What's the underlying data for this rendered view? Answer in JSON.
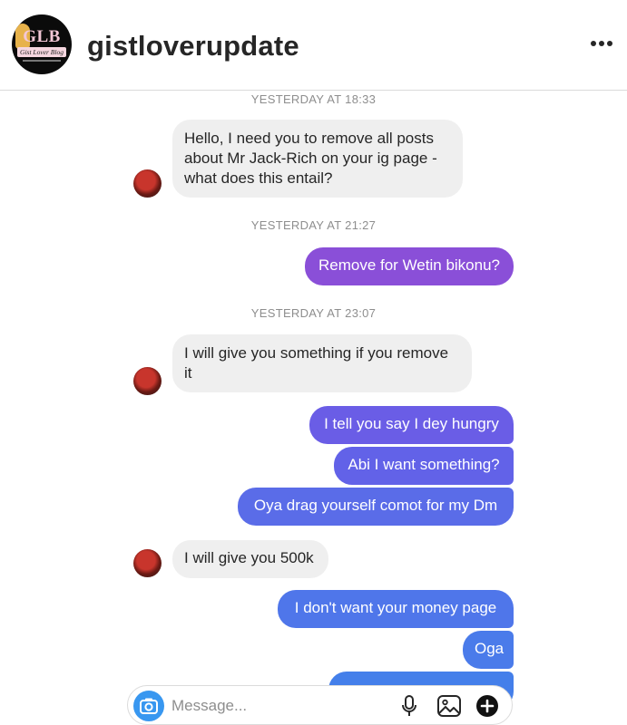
{
  "header": {
    "username": "gistloverupdate",
    "avatar": {
      "logo_text": "GLB",
      "logo_sub": "Gist Lover Blog"
    },
    "more_icon": "more-horizontal-icon"
  },
  "thread": [
    {
      "kind": "timestamp",
      "text": "YESTERDAY AT 18:33"
    },
    {
      "kind": "incoming",
      "text": "Hello, I need you to remove all posts about Mr Jack-Rich on your ig page - what does this entail?"
    },
    {
      "kind": "timestamp",
      "text": "YESTERDAY AT 21:27"
    },
    {
      "kind": "outgoing",
      "text": "Remove for Wetin bikonu?"
    },
    {
      "kind": "timestamp",
      "text": "YESTERDAY AT 23:07"
    },
    {
      "kind": "incoming",
      "text": "I will give you something if you remove it"
    },
    {
      "kind": "outgoing",
      "text": "I tell you say I dey hungry"
    },
    {
      "kind": "outgoing",
      "text": "Abi I want something?"
    },
    {
      "kind": "outgoing",
      "text": "Oya drag yourself comot for my Dm"
    },
    {
      "kind": "incoming",
      "text": "I will give you 500k"
    },
    {
      "kind": "outgoing",
      "text": "I don't want your money page"
    },
    {
      "kind": "outgoing",
      "text": "Oga"
    }
  ],
  "composer": {
    "placeholder": "Message...",
    "icons": [
      "camera-icon",
      "microphone-icon",
      "gallery-icon",
      "add-icon"
    ]
  },
  "colors": {
    "outgoing_purple": "#8a4fd8",
    "outgoing_indigo": "#6a5de6",
    "outgoing_blue": "#4d78ea",
    "incoming_bg": "#efefef",
    "camera_blue": "#3897f0"
  }
}
